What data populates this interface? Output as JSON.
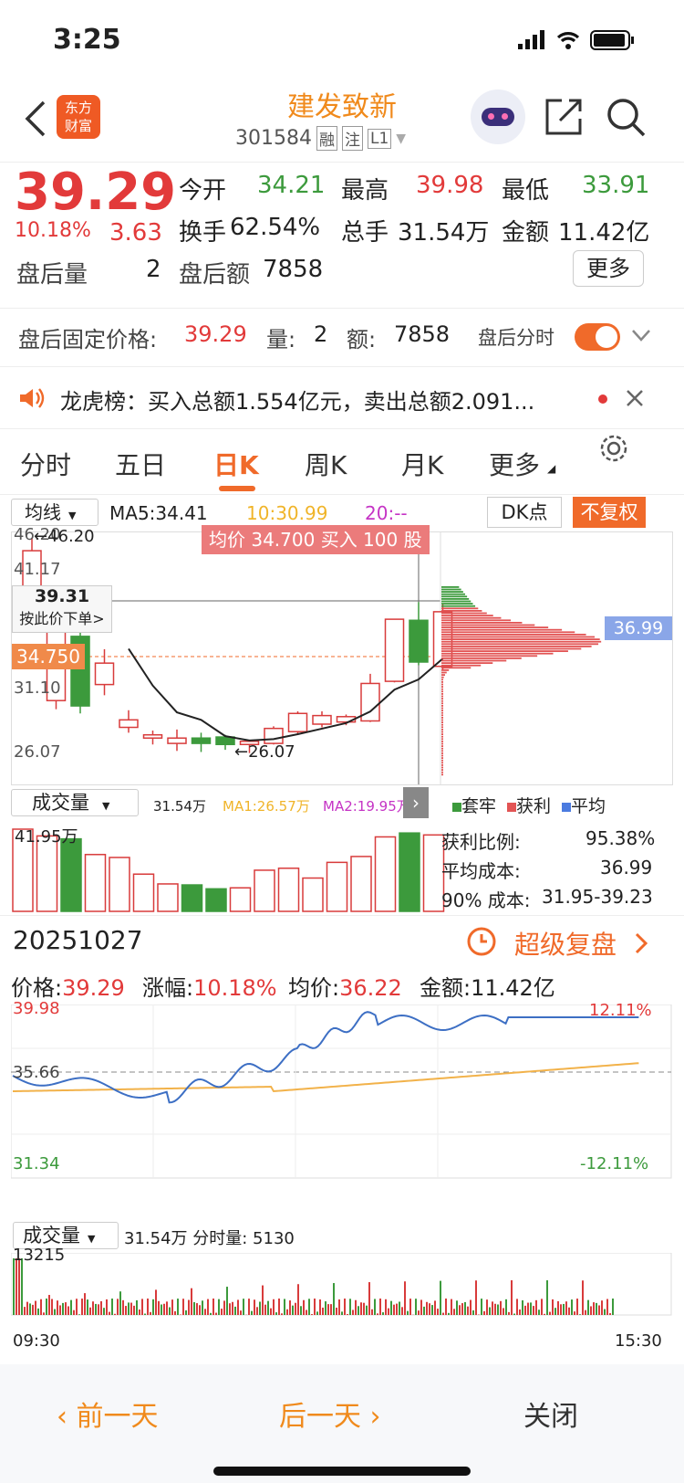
{
  "status": {
    "time": "3:25"
  },
  "header": {
    "stock_name": "建发致新",
    "code": "301584",
    "tags": [
      "融",
      "注",
      "L1"
    ],
    "logo_line1": "东方",
    "logo_line2": "财富"
  },
  "quote": {
    "price": "39.29",
    "pct": "10.18%",
    "chg": "3.63",
    "open_label": "今开",
    "open": "34.21",
    "high_label": "最高",
    "high": "39.98",
    "low_label": "最低",
    "low": "33.91",
    "turnover_label": "换手",
    "turnover": "62.54%",
    "vol_label": "总手",
    "vol": "31.54万",
    "amount_label": "金额",
    "amount": "11.42亿",
    "after_vol_label": "盘后量",
    "after_vol": "2",
    "after_amt_label": "盘后额",
    "after_amt": "7858",
    "more": "更多"
  },
  "after_hours": {
    "label": "盘后固定价格:",
    "price": "39.29",
    "vol_label": "量:",
    "vol": "2",
    "amt_label": "额:",
    "amt": "7858",
    "tick_label": "盘后分时"
  },
  "lhb": {
    "text": "龙虎榜：买入总额1.554亿元，卖出总额2.091..."
  },
  "tabs": [
    "分时",
    "五日",
    "日K",
    "周K",
    "月K",
    "更多"
  ],
  "kline": {
    "ma_select": "均线",
    "ma5": "MA5:34.41",
    "ma10": "10:30.99",
    "ma20": "20:--",
    "dk": "DK点",
    "fq": "不复权",
    "y_labels": [
      "46.20",
      "41.17",
      "31.10",
      "26.07"
    ],
    "hi_note": "←46.20",
    "lo_note": "←26.07",
    "cross_price": "39.31",
    "cross_hint": "按此价下单>",
    "cross_tag": "34.750",
    "banner": "均价 34.700 买入 100 股",
    "avg_cost_tag": "36.99"
  },
  "volume": {
    "select": "成交量",
    "vol": "31.54万",
    "ma1": "MA1:26.57万",
    "ma2": "MA2:19.95万",
    "max": "41.95万"
  },
  "chip": {
    "legend": [
      "套牢",
      "获利",
      "平均"
    ],
    "profit_label": "获利比例:",
    "profit": "95.38%",
    "avg_label": "平均成本:",
    "avg": "36.99",
    "range_label": "90% 成本:",
    "range": "31.95-39.23"
  },
  "day": {
    "date": "20251027",
    "replay": "超级复盘",
    "price_label": "价格:",
    "price": "39.29",
    "pct_label": "涨幅:",
    "pct": "10.18%",
    "avg_label": "均价:",
    "avg": "36.22",
    "amt_label": "金额:",
    "amt": "11.42亿"
  },
  "minute": {
    "top": "39.98",
    "mid": "35.66",
    "bottom": "31.34",
    "top_pct": "12.11%",
    "bottom_pct": "-12.11%",
    "start": "09:30",
    "end": "15:30"
  },
  "mvol": {
    "select": "成交量",
    "info": "31.54万 分时量: 5130",
    "max": "13215"
  },
  "footer": {
    "prev": "前一天",
    "next": "后一天",
    "close": "关闭"
  },
  "chart_data": {
    "type": "candlestick",
    "candles": [
      [
        40.5,
        45.0,
        40.0,
        46.2
      ],
      [
        31.0,
        40.0,
        30.2,
        41.2
      ],
      [
        37.0,
        30.5,
        29.8,
        37.8
      ],
      [
        32.5,
        34.5,
        31.5,
        35.8
      ],
      [
        28.5,
        29.2,
        28.0,
        30.1
      ],
      [
        27.5,
        27.8,
        26.9,
        28.2
      ],
      [
        27.0,
        27.5,
        26.3,
        28.3
      ],
      [
        27.5,
        27.0,
        26.2,
        28.0
      ],
      [
        27.6,
        26.9,
        26.4,
        27.8
      ],
      [
        26.9,
        27.2,
        26.1,
        27.3
      ],
      [
        27.0,
        28.4,
        26.9,
        28.6
      ],
      [
        28.1,
        29.8,
        27.8,
        30.0
      ],
      [
        28.8,
        29.6,
        28.5,
        30.0
      ],
      [
        29.0,
        29.5,
        28.7,
        29.7
      ],
      [
        29.1,
        32.6,
        29.0,
        33.5
      ],
      [
        32.8,
        38.6,
        32.7,
        38.6
      ],
      [
        38.5,
        34.6,
        34.3,
        40.2
      ],
      [
        34.2,
        39.3,
        33.9,
        40.0
      ]
    ],
    "ohlc_order": "open,close,low,high",
    "volume": [
      41.95,
      38.5,
      37.0,
      29.0,
      27.5,
      19.0,
      14.0,
      13.5,
      11.5,
      12.0,
      21.0,
      22.0,
      17.0,
      25.0,
      28.0,
      38.0,
      40.0,
      39.0
    ]
  }
}
